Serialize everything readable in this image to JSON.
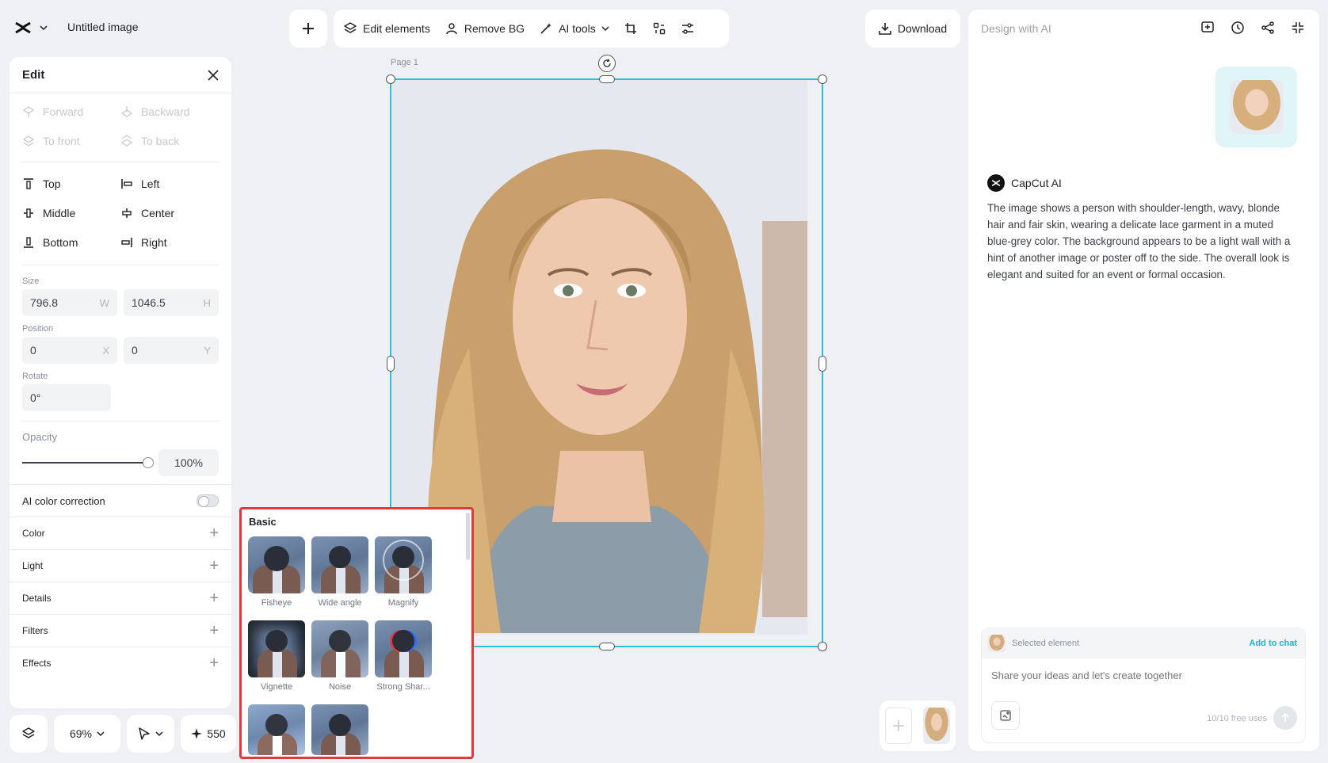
{
  "app": {
    "title": "Untitled image"
  },
  "toolbar": {
    "edit_elements": "Edit elements",
    "remove_bg": "Remove BG",
    "ai_tools": "AI tools",
    "download": "Download"
  },
  "edit_panel": {
    "title": "Edit",
    "arrange": [
      "Forward",
      "Backward",
      "To front",
      "To back"
    ],
    "align": [
      "Top",
      "Left",
      "Middle",
      "Center",
      "Bottom",
      "Right"
    ],
    "size_label": "Size",
    "width": "796.8",
    "width_suffix": "W",
    "height": "1046.5",
    "height_suffix": "H",
    "position_label": "Position",
    "pos_x": "0",
    "pos_x_suffix": "X",
    "pos_y": "0",
    "pos_y_suffix": "Y",
    "rotate_label": "Rotate",
    "rotate": "0°",
    "opacity_label": "Opacity",
    "opacity": "100%",
    "opacity_level": 1.0,
    "ai_color_correction": "AI color correction",
    "ai_color_correction_on": false,
    "accordions": [
      "Color",
      "Light",
      "Details",
      "Filters",
      "Effects"
    ]
  },
  "bottom_controls": {
    "zoom": "69%",
    "credits": "550"
  },
  "canvas": {
    "page_label": "Page 1"
  },
  "effects_popup": {
    "title": "Basic",
    "items": [
      "Fisheye",
      "Wide angle",
      "Magnify",
      "Vignette",
      "Noise",
      "Strong Shar...",
      "",
      ""
    ]
  },
  "ai_panel": {
    "title": "Design with AI",
    "bot_name": "CapCut AI",
    "message": "The image shows a person with shoulder-length, wavy, blonde hair and fair skin, wearing a delicate lace garment in a muted blue-grey color. The background appears to be a light wall with a hint of another image or poster off to the side. The overall look is elegant and suited for an event or formal occasion.",
    "selected_element": "Selected element",
    "add_to_chat": "Add to chat",
    "input_placeholder": "Share your ideas and let's create together",
    "free_uses": "10/10 free uses"
  },
  "colors": {
    "accent": "#25c2d9",
    "highlight_border": "#e0393e",
    "link": "#19b5cb"
  },
  "icons": [
    "capcut-logo-icon",
    "chevron-down-icon",
    "plus-icon",
    "layers-icon",
    "person-icon",
    "magic-wand-icon",
    "crop-icon",
    "arrange-icon",
    "adjust-icon",
    "download-icon",
    "close-icon",
    "pointer-icon",
    "sparkle-icon",
    "rotate-icon",
    "new-chat-icon",
    "history-icon",
    "share-icon",
    "collapse-icon",
    "attach-image-icon",
    "send-icon"
  ]
}
